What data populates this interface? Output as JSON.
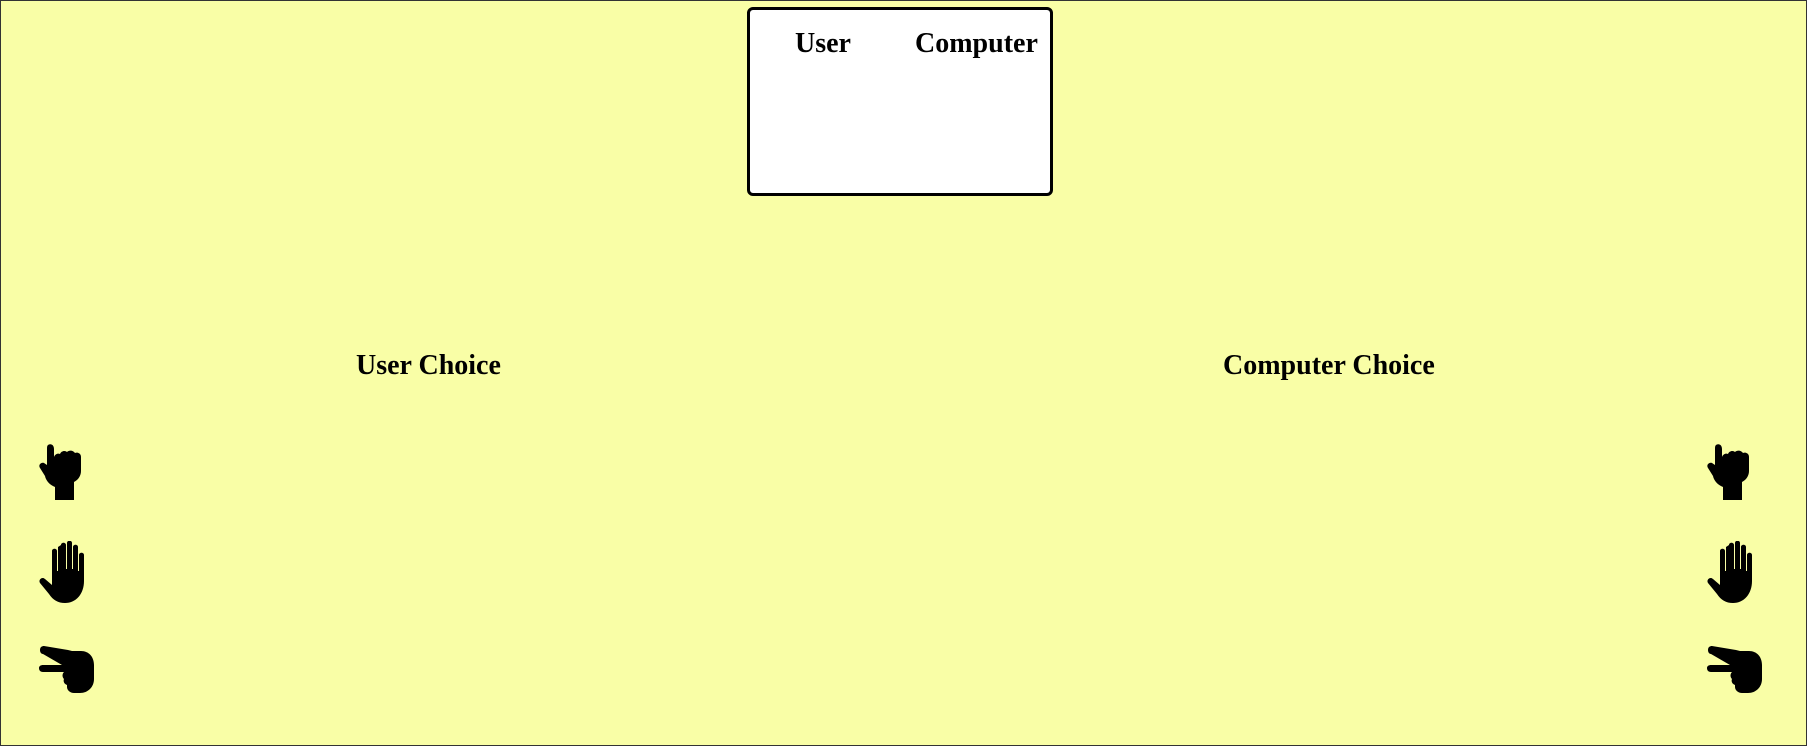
{
  "scoreboard": {
    "user_label": "User",
    "computer_label": "Computer",
    "user_score": "",
    "computer_score": ""
  },
  "user_panel": {
    "title": "User Choice",
    "choices": [
      {
        "name": "rock",
        "icon": "hand-rock-icon"
      },
      {
        "name": "paper",
        "icon": "hand-paper-icon"
      },
      {
        "name": "scissors",
        "icon": "hand-scissors-icon"
      }
    ]
  },
  "computer_panel": {
    "title": "Computer Choice",
    "choices": [
      {
        "name": "rock",
        "icon": "hand-rock-icon"
      },
      {
        "name": "paper",
        "icon": "hand-paper-icon"
      },
      {
        "name": "scissors",
        "icon": "hand-scissors-icon"
      }
    ]
  },
  "colors": {
    "background": "#f9fea6",
    "scoreboard_bg": "#ffffff",
    "icon": "#000000"
  }
}
